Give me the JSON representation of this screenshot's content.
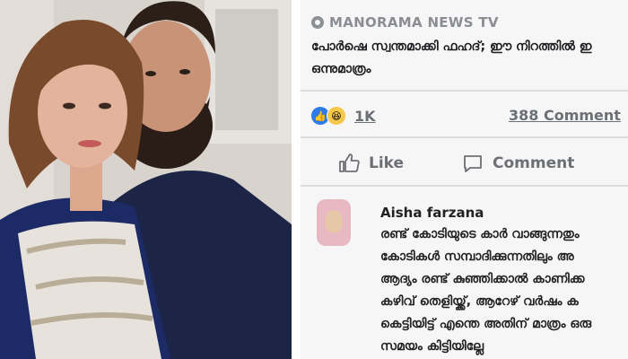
{
  "post": {
    "source": "MANORAMA NEWS TV",
    "headline_lines": [
      "പോർഷെ സ്വന്തമാക്കി ഫഹദ്; ഈ നിറത്തിൽ ഇ",
      "ഒന്നുമാത്രം"
    ]
  },
  "stats": {
    "reaction_count": "1K",
    "comment_count": "388 Comment"
  },
  "actions": {
    "like_label": "Like",
    "comment_label": "Comment"
  },
  "comment": {
    "author": "Aisha farzana",
    "lines": [
      "രണ്ട് കോടിയുടെ കാർ വാങ്ങുന്നതും",
      "കോടികൾ സമ്പാദിക്കുന്നതിലും അ",
      "ആദ്യം രണ്ട് കുഞ്ഞിക്കാൽ കാണിക്ക",
      "കഴിവ് തെളിയ്ക്ക്, ആറേഴ് വർഷം ക",
      "കെട്ടിയിട്ട് എന്തെ അതിന് മാത്രം ഒരു",
      "സമയം കിട്ടിയില്ലേ"
    ]
  },
  "colors": {
    "like_blue": "#2d7be6",
    "text_gray": "#6c6f74",
    "panel_bg": "#f1f2f4"
  },
  "icons": [
    "source-icon",
    "like-reaction-icon",
    "haha-reaction-icon",
    "thumbs-up-icon",
    "comment-bubble-icon"
  ]
}
